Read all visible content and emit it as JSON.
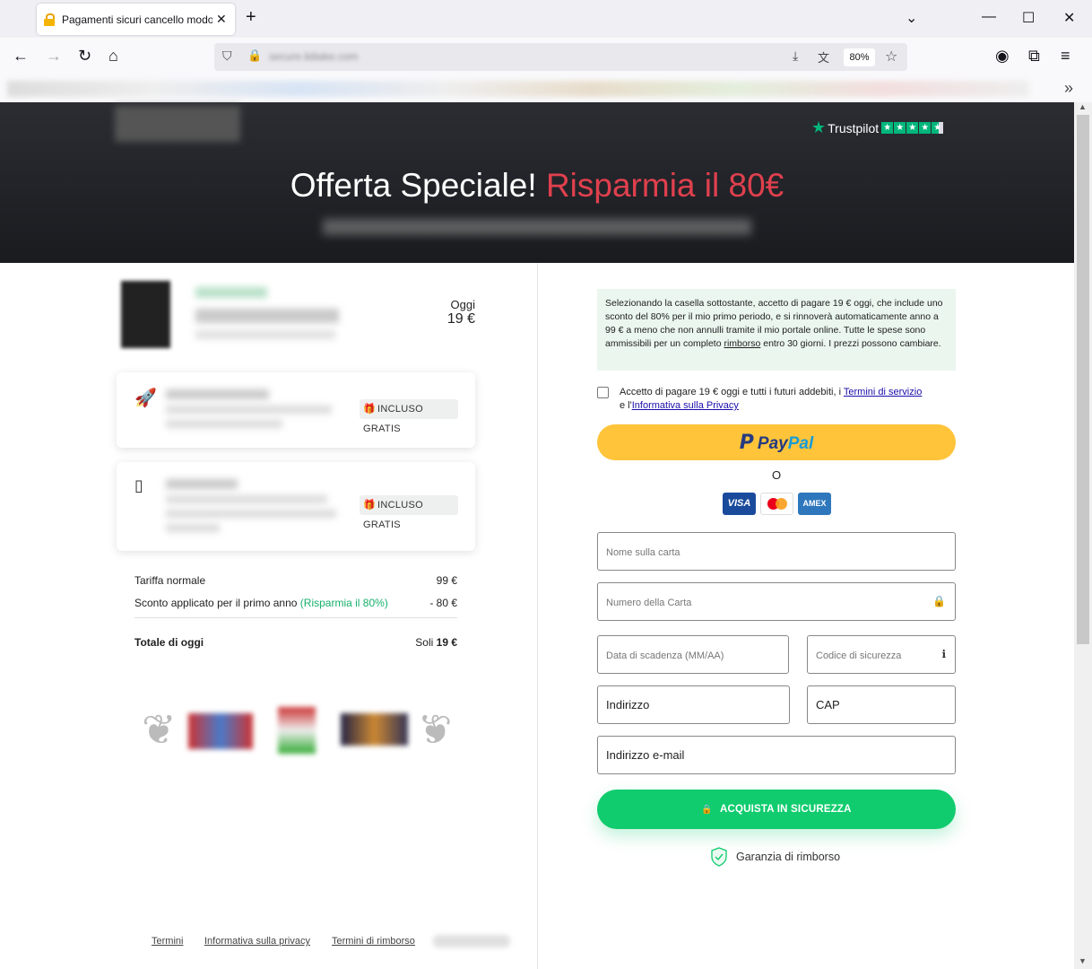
{
  "browser": {
    "tab_title": "Pagamenti sicuri cancello modo",
    "url": "secure.lidiake.com",
    "zoom": "80%"
  },
  "hero": {
    "trustpilot": "Trustpilot",
    "title_main": "Offerta Speciale!",
    "title_accent": "Risparmia il 80€"
  },
  "product": {
    "period_label": "Oggi",
    "price": "19 €"
  },
  "features": [
    {
      "badge": "INCLUSO GRATIS"
    },
    {
      "badge": "INCLUSO GRATIS"
    }
  ],
  "summary": {
    "rows": [
      {
        "label": "Tariffa normale",
        "value": "99 €"
      },
      {
        "label": "Sconto applicato per il primo anno",
        "highlight": "(Risparmia il 80%)",
        "value": "- 80 €"
      }
    ],
    "total_label": "Totale di oggi",
    "total_prefix": "Soli",
    "total_value": "19 €"
  },
  "footer": {
    "links": [
      "Termini",
      "Informativa sulla privacy",
      "Termini di rimborso"
    ]
  },
  "checkout": {
    "notice_part1": "Selezionando la casella sottostante, accetto di pagare 19 € oggi, che include uno sconto del 80% per il mio primo periodo, e si rinnoverà automaticamente anno a 99 € a meno che non annulli tramite il mio portale online. Tutte le spese sono ammissibili per un completo ",
    "notice_link": "rimborso",
    "notice_part2": " entro 30 giorni. I prezzi possono cambiare.",
    "agree_text": "Accetto di pagare 19 € oggi e tutti i futuri addebiti, i ",
    "agree_terms": "Termini di servizio",
    "agree_and": "e l'",
    "agree_privacy": "Informativa sulla Privacy",
    "paypal_a": "Pay",
    "paypal_b": "Pal",
    "or": "O",
    "cards": [
      {
        "name": "VISA",
        "color": "#1a4a9c"
      },
      {
        "name": "",
        "color": "#ffffff"
      },
      {
        "name": "AMEX",
        "color": "#2e77bc"
      }
    ],
    "fields": {
      "card_name_placeholder": "Nome sulla carta",
      "card_number_placeholder": "Numero della Carta",
      "expiry_placeholder": "Data di scadenza (MM/AA)",
      "cvc_placeholder": "Codice di sicurezza",
      "address": "Indirizzo",
      "zip": "CAP",
      "email": "Indirizzo e-mail"
    },
    "buy_button": "ACQUISTA IN SICUREZZA",
    "guarantee": "Garanzia di rimborso"
  }
}
